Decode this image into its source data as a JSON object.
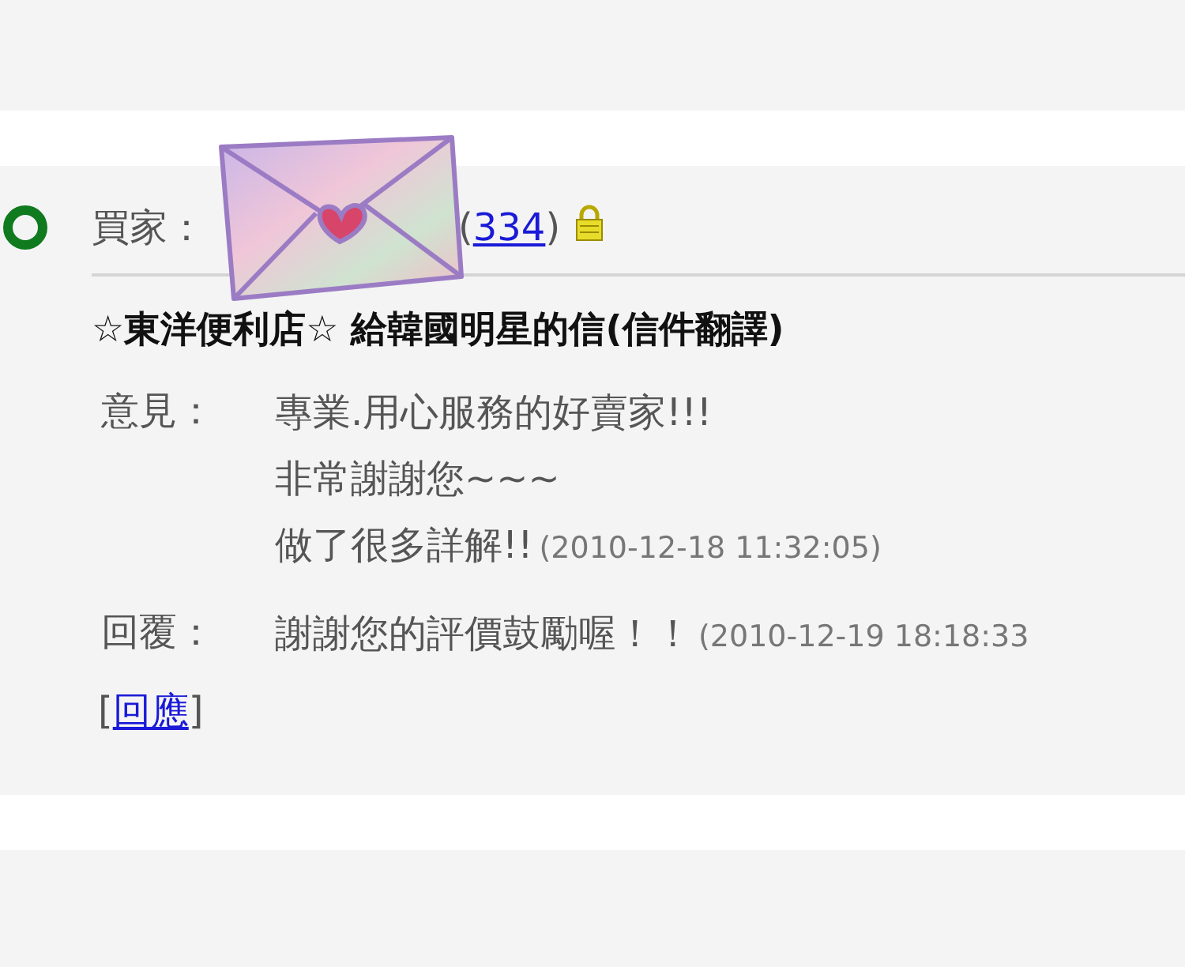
{
  "buyer": {
    "label": "買家：",
    "score_open": "(",
    "score": "334",
    "score_close": ")"
  },
  "title": "☆東洋便利店☆ 給韓國明星的信(信件翻譯)",
  "comments": [
    {
      "label": "意見：",
      "lines": [
        "專業.用心服務的好賣家!!!",
        "非常謝謝您~~~",
        "做了很多詳解!!"
      ],
      "time": "(2010-12-18 11:32:05)"
    },
    {
      "label": "回覆：",
      "lines": [
        "謝謝您的評價鼓勵喔！！"
      ],
      "time": "(2010-12-19 18:18:33"
    }
  ],
  "reply": {
    "open": "[",
    "label": "回應",
    "close": "]"
  }
}
